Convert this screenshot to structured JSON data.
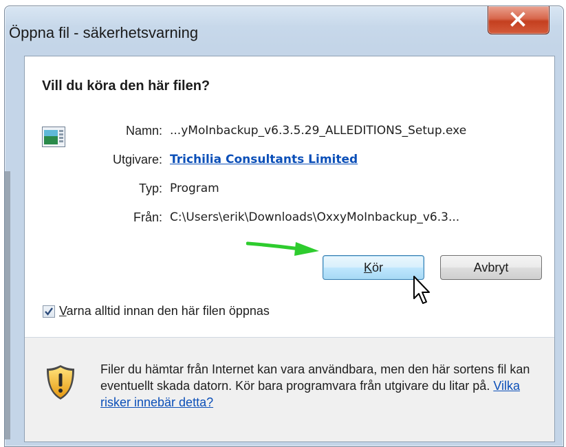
{
  "window": {
    "title": "Öppna fil - säkerhetsvarning",
    "close_label": "X"
  },
  "dialog": {
    "heading": "Vill du köra den här filen?",
    "file_icon": "application-window-icon",
    "fields": [
      {
        "label": "Namn:",
        "value": "...yMoInbackup_v6.3.5.29_ALLEDITIONS_Setup.exe"
      },
      {
        "label": "Utgivare:",
        "value": "Trichilia Consultants Limited"
      },
      {
        "label": "Typ:",
        "value": "Program"
      },
      {
        "label": "Från:",
        "value": "C:\\Users\\erik\\Downloads\\OxxyMoInbackup_v6.3..."
      }
    ],
    "buttons": {
      "run": {
        "label_underlined": "K",
        "label_rest": "ör"
      },
      "cancel": {
        "label": "Avbryt"
      }
    },
    "checkbox": {
      "checked": true,
      "label_underlined": "V",
      "label_rest": "arna alltid innan den här filen öppnas"
    },
    "footer": {
      "icon": "warning-shield-icon",
      "text": "Filer du hämtar från Internet kan vara användbara, men den här sortens fil kan eventuellt skada datorn. Kör bara programvara från utgivare du litar på. ",
      "link": "Vilka risker innebär detta?"
    }
  },
  "colors": {
    "accent_link": "#0b4fb8",
    "annotation_arrow": "#2ecc2e",
    "close_button": "#c43f1f"
  }
}
